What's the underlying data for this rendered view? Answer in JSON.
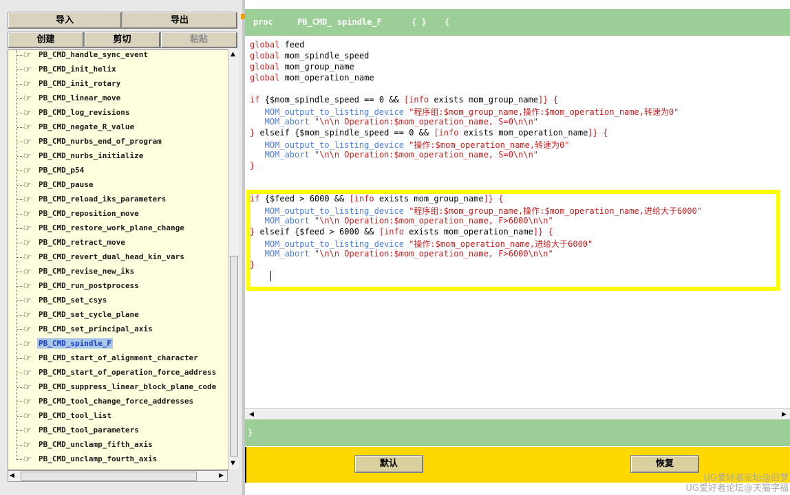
{
  "toolbar": {
    "import_label": "导入",
    "export_label": "导出",
    "create_label": "创建",
    "cut_label": "剪切",
    "paste_label": "粘贴"
  },
  "tree": {
    "items": [
      {
        "label": "PB_CMD_handle_sync_event"
      },
      {
        "label": "PB_CMD_init_helix"
      },
      {
        "label": "PB_CMD_init_rotary"
      },
      {
        "label": "PB_CMD_linear_move"
      },
      {
        "label": "PB_CMD_log_revisions"
      },
      {
        "label": "PB_CMD_negate_R_value"
      },
      {
        "label": "PB_CMD_nurbs_end_of_program"
      },
      {
        "label": "PB_CMD_nurbs_initialize"
      },
      {
        "label": "PB_CMD_p54"
      },
      {
        "label": "PB_CMD_pause"
      },
      {
        "label": "PB_CMD_reload_iks_parameters"
      },
      {
        "label": "PB_CMD_reposition_move"
      },
      {
        "label": "PB_CMD_restore_work_plane_change"
      },
      {
        "label": "PB_CMD_retract_move"
      },
      {
        "label": "PB_CMD_revert_dual_head_kin_vars"
      },
      {
        "label": "PB_CMD_revise_new_iks"
      },
      {
        "label": "PB_CMD_run_postprocess"
      },
      {
        "label": "PB_CMD_set_csys"
      },
      {
        "label": "PB_CMD_set_cycle_plane"
      },
      {
        "label": "PB_CMD_set_principal_axis"
      },
      {
        "label": "PB_CMD_spindle_F",
        "selected": true
      },
      {
        "label": "PB_CMD_start_of_alignment_character"
      },
      {
        "label": "PB_CMD_start_of_operation_force_address"
      },
      {
        "label": "PB_CMD_suppress_linear_block_plane_code"
      },
      {
        "label": "PB_CMD_tool_change_force_addresses"
      },
      {
        "label": "PB_CMD_tool_list"
      },
      {
        "label": "PB_CMD_tool_parameters"
      },
      {
        "label": "PB_CMD_unclamp_fifth_axis"
      },
      {
        "label": "PB_CMD_unclamp_fourth_axis"
      }
    ],
    "item_icon": "command-icon"
  },
  "editor": {
    "proc_keyword": "proc",
    "proc_name": "PB_CMD_ spindle_F",
    "proc_args": "{ }",
    "proc_open": "{",
    "closing_brace": "}",
    "lines": [
      [
        {
          "t": "global",
          "c": "kw"
        },
        {
          "t": " feed",
          "c": "vr"
        }
      ],
      [
        {
          "t": "global",
          "c": "kw"
        },
        {
          "t": " mom_spindle_speed",
          "c": "vr"
        }
      ],
      [
        {
          "t": "global",
          "c": "kw"
        },
        {
          "t": " mom_group_name",
          "c": "vr"
        }
      ],
      [
        {
          "t": "global",
          "c": "kw"
        },
        {
          "t": " mom_operation_name",
          "c": "vr"
        }
      ],
      [],
      [
        {
          "t": "if",
          "c": "kw"
        },
        {
          "t": " {$mom_spindle_speed == 0 && ",
          "c": "vr"
        },
        {
          "t": "[info",
          "c": "kw"
        },
        {
          "t": " exists mom_group_name",
          "c": "vr"
        },
        {
          "t": "]} {",
          "c": "kw"
        }
      ],
      [
        {
          "t": "   MOM_output_to_listing_device",
          "c": "fn"
        },
        {
          "t": " \"程序组:$mom_group_name,操作:$mom_operation_name,转速为0\"",
          "c": "st"
        }
      ],
      [
        {
          "t": "   MOM_abort",
          "c": "fn"
        },
        {
          "t": " \"\\n\\n Operation:$mom_operation_name, S=0\\n\\n\"",
          "c": "st"
        }
      ],
      [
        {
          "t": "} ",
          "c": "kw"
        },
        {
          "t": "elseif {$mom_spindle_speed == 0 && ",
          "c": "vr"
        },
        {
          "t": "[info",
          "c": "kw"
        },
        {
          "t": " exists mom_operation_name",
          "c": "vr"
        },
        {
          "t": "]} {",
          "c": "kw"
        }
      ],
      [
        {
          "t": "   MOM_output_to_listing_device",
          "c": "fn"
        },
        {
          "t": " \"操作:$mom_operation_name,转速为0\"",
          "c": "st"
        }
      ],
      [
        {
          "t": "   MOM_abort",
          "c": "fn"
        },
        {
          "t": " \"\\n\\n Operation:$mom_operation_name, S=0\\n\\n\"",
          "c": "st"
        }
      ],
      [
        {
          "t": "}",
          "c": "kw"
        }
      ],
      [],
      [],
      [
        {
          "t": "if",
          "c": "kw"
        },
        {
          "t": " {$feed > 6000 && ",
          "c": "vr"
        },
        {
          "t": "[info",
          "c": "kw"
        },
        {
          "t": " exists mom_group_name",
          "c": "vr"
        },
        {
          "t": "]} {",
          "c": "kw"
        }
      ],
      [
        {
          "t": "   MOM_output_to_listing_device",
          "c": "fn"
        },
        {
          "t": " \"程序组:$mom_group_name,操作:$mom_operation_name,进给大于6000\"",
          "c": "st"
        }
      ],
      [
        {
          "t": "   MOM_abort",
          "c": "fn"
        },
        {
          "t": " \"\\n\\n Operation:$mom_operation_name, F>6000\\n\\n\"",
          "c": "st"
        }
      ],
      [
        {
          "t": "} ",
          "c": "kw"
        },
        {
          "t": "elseif {$feed > 6000 && ",
          "c": "vr"
        },
        {
          "t": "[info",
          "c": "kw"
        },
        {
          "t": " exists mom_operation_name",
          "c": "vr"
        },
        {
          "t": "]} {",
          "c": "kw"
        }
      ],
      [
        {
          "t": "   MOM_output_to_listing_device",
          "c": "fn"
        },
        {
          "t": " \"操作:$mom_operation_name,进给大于6000\"",
          "c": "st"
        }
      ],
      [
        {
          "t": "   MOM_abort",
          "c": "fn"
        },
        {
          "t": " \"\\n\\n Operation:$mom_operation_name, F>6000\\n\\n\"",
          "c": "st"
        }
      ],
      [
        {
          "t": "}",
          "c": "kw"
        }
      ]
    ]
  },
  "buttons": {
    "default_label": "默认",
    "restore_label": "恢复"
  },
  "watermark": {
    "line1": "UG爱好者论坛@旧梦",
    "line2": "UG爱好者论坛@天猫字福"
  },
  "colors": {
    "accent_green": "#9ccf98",
    "highlight_yellow": "#ffff00",
    "footer_yellow": "#ffd800",
    "keyword_red": "#c81e1e",
    "command_blue": "#4a7ee0",
    "tree_bg": "#ffffdf"
  }
}
